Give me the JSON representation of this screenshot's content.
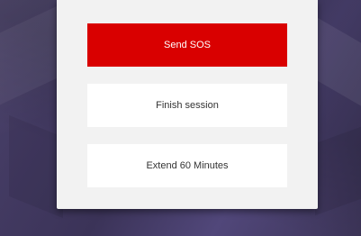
{
  "dialog": {
    "buttons": {
      "sos_label": "Send SOS",
      "finish_label": "Finish session",
      "extend_label": "Extend 60 Minutes"
    }
  },
  "colors": {
    "sos": "#d90000",
    "dialog_bg": "#f2f2f2",
    "backdrop": "#443c63"
  }
}
